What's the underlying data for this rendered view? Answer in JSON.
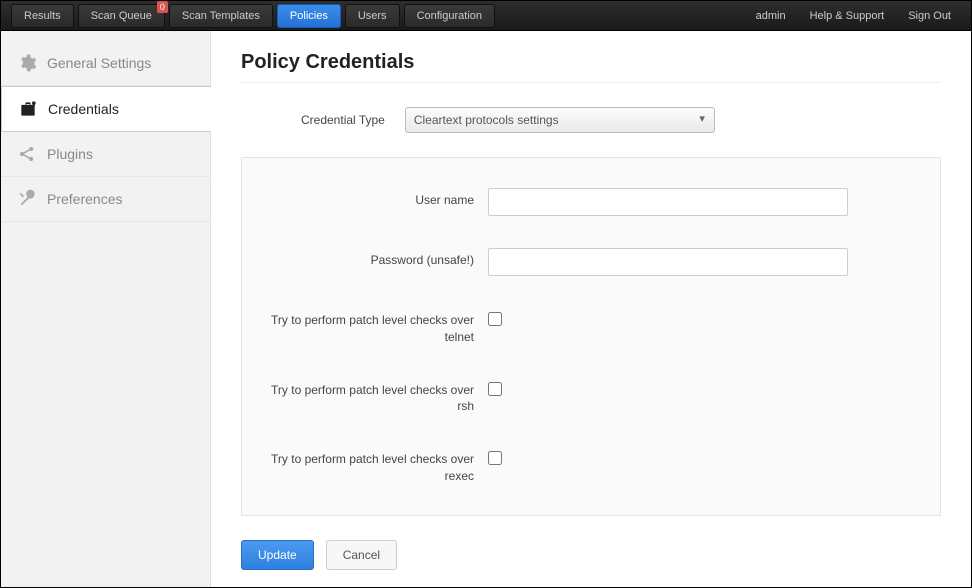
{
  "topnav": {
    "items": [
      {
        "label": "Results",
        "active": false
      },
      {
        "label": "Scan Queue",
        "active": false,
        "badge": "0"
      },
      {
        "label": "Scan Templates",
        "active": false
      },
      {
        "label": "Policies",
        "active": true
      },
      {
        "label": "Users",
        "active": false
      },
      {
        "label": "Configuration",
        "active": false
      }
    ],
    "right": {
      "user": "admin",
      "help": "Help & Support",
      "signout": "Sign Out"
    }
  },
  "sidebar": {
    "items": [
      {
        "label": "General Settings",
        "icon": "gear-icon",
        "active": false
      },
      {
        "label": "Credentials",
        "icon": "briefcase-lock-icon",
        "active": true
      },
      {
        "label": "Plugins",
        "icon": "share-icon",
        "active": false
      },
      {
        "label": "Preferences",
        "icon": "wrench-icon",
        "active": false
      }
    ]
  },
  "page": {
    "title": "Policy Credentials",
    "credential_type_label": "Credential Type",
    "credential_type_value": "Cleartext protocols settings",
    "fields": {
      "username_label": "User name",
      "username_value": "",
      "password_label": "Password (unsafe!)",
      "password_value": "",
      "check_telnet_label": "Try to perform patch level checks over telnet",
      "check_telnet_value": false,
      "check_rsh_label": "Try to perform patch level checks over rsh",
      "check_rsh_value": false,
      "check_rexec_label": "Try to perform patch level checks over rexec",
      "check_rexec_value": false
    },
    "buttons": {
      "update": "Update",
      "cancel": "Cancel"
    }
  }
}
